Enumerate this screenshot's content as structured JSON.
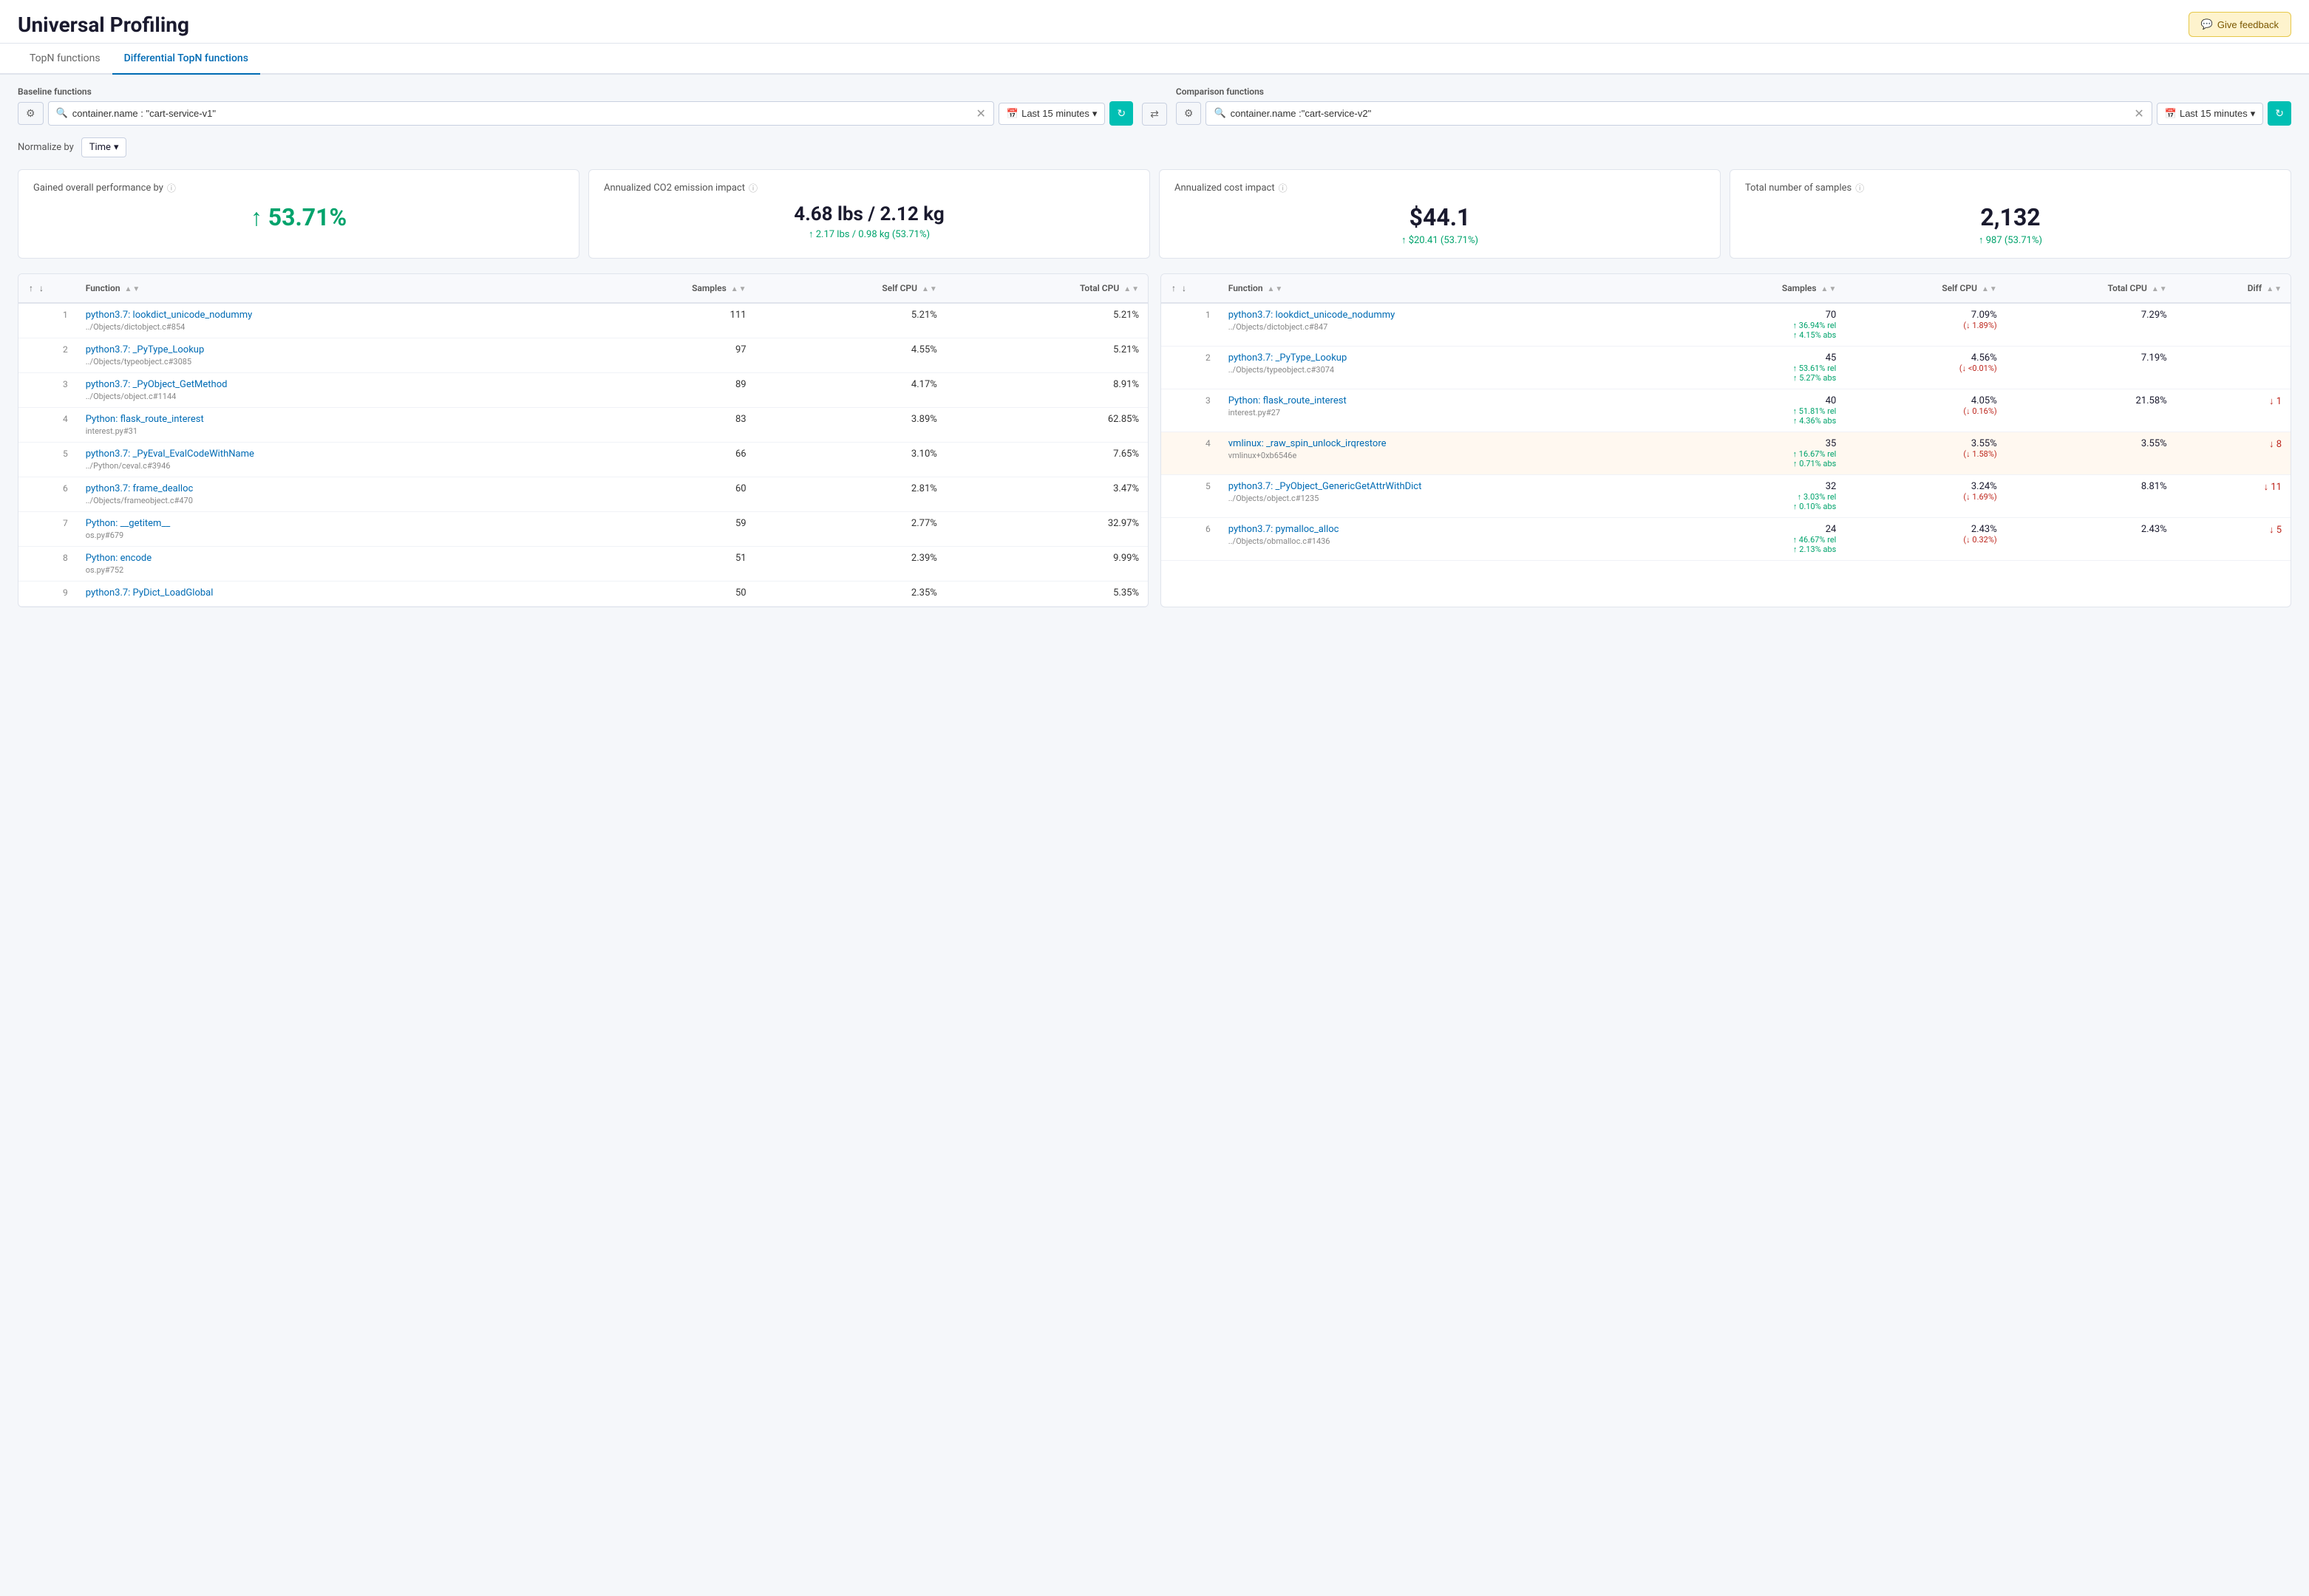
{
  "header": {
    "title": "Universal Profiling",
    "feedback_label": "Give feedback"
  },
  "tabs": [
    {
      "id": "topn",
      "label": "TopN functions",
      "active": false
    },
    {
      "id": "differential",
      "label": "Differential TopN functions",
      "active": true
    }
  ],
  "baseline": {
    "label": "Baseline functions",
    "filter_value": "container.name : \"cart-service-v1\"",
    "time_range": "Last 15 minutes"
  },
  "comparison": {
    "label": "Comparison functions",
    "filter_value": "container.name :\"cart-service-v2\"",
    "time_range": "Last 15 minutes"
  },
  "normalize": {
    "label": "Normalize by",
    "value": "Time"
  },
  "metrics": [
    {
      "id": "performance",
      "title": "Gained overall performance by",
      "value": "53.71%",
      "value_color": "#00a36c",
      "arrow": "↑",
      "sub": ""
    },
    {
      "id": "co2",
      "title": "Annualized CO2 emission impact",
      "value": "4.68 lbs / 2.12 kg",
      "value_color": "#1a1a2e",
      "sub": "↑ 2.17 lbs / 0.98 kg (53.71%)",
      "sub_color": "#00a36c"
    },
    {
      "id": "cost",
      "title": "Annualized cost impact",
      "value": "$44.1",
      "value_color": "#1a1a2e",
      "sub": "↑ $20.41 (53.71%)",
      "sub_color": "#00a36c"
    },
    {
      "id": "samples",
      "title": "Total number of samples",
      "value": "2,132",
      "value_color": "#1a1a2e",
      "sub": "↑ 987 (53.71%)",
      "sub_color": "#00a36c"
    }
  ],
  "left_table": {
    "columns": [
      "",
      "",
      "Function",
      "Samples",
      "Self CPU",
      "Total CPU"
    ],
    "rows": [
      {
        "rank": 1,
        "func": "python3.7: lookdict_unicode_nodummy",
        "file": "../Objects/dictobject.c#854",
        "samples": 111,
        "self_cpu": "5.21%",
        "total_cpu": "5.21%"
      },
      {
        "rank": 2,
        "func": "python3.7: _PyType_Lookup",
        "file": "../Objects/typeobject.c#3085",
        "samples": 97,
        "self_cpu": "4.55%",
        "total_cpu": "5.21%"
      },
      {
        "rank": 3,
        "func": "python3.7: _PyObject_GetMethod",
        "file": "../Objects/object.c#1144",
        "samples": 89,
        "self_cpu": "4.17%",
        "total_cpu": "8.91%"
      },
      {
        "rank": 4,
        "func": "Python: flask_route_interest",
        "file": "interest.py#31",
        "samples": 83,
        "self_cpu": "3.89%",
        "total_cpu": "62.85%"
      },
      {
        "rank": 5,
        "func": "python3.7: _PyEval_EvalCodeWithName",
        "file": "../Python/ceval.c#3946",
        "samples": 66,
        "self_cpu": "3.10%",
        "total_cpu": "7.65%"
      },
      {
        "rank": 6,
        "func": "python3.7: frame_dealloc",
        "file": "../Objects/frameobject.c#470",
        "samples": 60,
        "self_cpu": "2.81%",
        "total_cpu": "3.47%"
      },
      {
        "rank": 7,
        "func": "Python: __getitem__",
        "file": "os.py#679",
        "samples": 59,
        "self_cpu": "2.77%",
        "total_cpu": "32.97%"
      },
      {
        "rank": 8,
        "func": "Python: encode",
        "file": "os.py#752",
        "samples": 51,
        "self_cpu": "2.39%",
        "total_cpu": "9.99%"
      },
      {
        "rank": 9,
        "func": "python3.7: PyDict_LoadGlobal",
        "file": "",
        "samples": 50,
        "self_cpu": "2.35%",
        "total_cpu": "5.35%"
      }
    ]
  },
  "right_table": {
    "columns": [
      "",
      "",
      "Function",
      "Samples",
      "Self CPU",
      "Total CPU",
      "Diff"
    ],
    "rows": [
      {
        "rank": 1,
        "func": "python3.7: lookdict_unicode_nodummy",
        "file": "../Objects/dictobject.c#847",
        "samples": 70,
        "self_cpu": "7.09%",
        "total_cpu": "7.29%",
        "change1": "↑ 36.94% rel",
        "change2": "(↓ 1.89%)",
        "change3": "↑ 4.15% abs",
        "change1_color": "up",
        "change2_color": "down",
        "diff": "",
        "highlighted": false
      },
      {
        "rank": 2,
        "func": "python3.7: _PyType_Lookup",
        "file": "../Objects/typeobject.c#3074",
        "samples": 45,
        "self_cpu": "4.56%",
        "total_cpu": "7.19%",
        "change1": "↑ 53.61% rel",
        "change2": "(↓ <0.01%)",
        "change3": "↑ 5.27% abs",
        "change1_color": "up",
        "change2_color": "down",
        "diff": "",
        "highlighted": false
      },
      {
        "rank": 3,
        "func": "Python: flask_route_interest",
        "file": "interest.py#27",
        "samples": 40,
        "self_cpu": "4.05%",
        "total_cpu": "21.58%",
        "change1": "↑ 51.81% rel",
        "change2": "(↓ 0.16%)",
        "change3": "↑ 4.36% abs",
        "change1_color": "up",
        "change2_color": "down",
        "diff": "↓ 1",
        "diff_color": "down",
        "highlighted": false
      },
      {
        "rank": 4,
        "func": "vmlinux: _raw_spin_unlock_irqrestore",
        "file": "vmlinux+0xb6546e",
        "samples": 35,
        "self_cpu": "3.55%",
        "total_cpu": "3.55%",
        "change1": "↑ 16.67% rel",
        "change2": "(↓ 1.58%)",
        "change3": "↑ 0.71% abs",
        "change1_color": "up",
        "change2_color": "down",
        "diff": "↓ 8",
        "diff_color": "down",
        "highlighted": true
      },
      {
        "rank": 5,
        "func": "python3.7: _PyObject_GenericGetAttrWithDict",
        "file": "../Objects/object.c#1235",
        "samples": 32,
        "self_cpu": "3.24%",
        "total_cpu": "8.81%",
        "change1": "↑ 3.03% rel",
        "change2": "(↓ 1.69%)",
        "change3": "↑ 0.10% abs",
        "change1_color": "up",
        "change2_color": "down",
        "diff": "↓ 11",
        "diff_color": "down",
        "highlighted": false
      },
      {
        "rank": 6,
        "func": "python3.7: pymalloc_alloc",
        "file": "../Objects/obmalloc.c#1436",
        "samples": 24,
        "self_cpu": "2.43%",
        "total_cpu": "2.43%",
        "change1": "↑ 46.67% rel",
        "change2": "(↓ 0.32%)",
        "change3": "↑ 2.13% abs",
        "change1_color": "up",
        "change2_color": "down",
        "diff": "↓ 5",
        "diff_color": "down",
        "highlighted": false
      }
    ]
  }
}
